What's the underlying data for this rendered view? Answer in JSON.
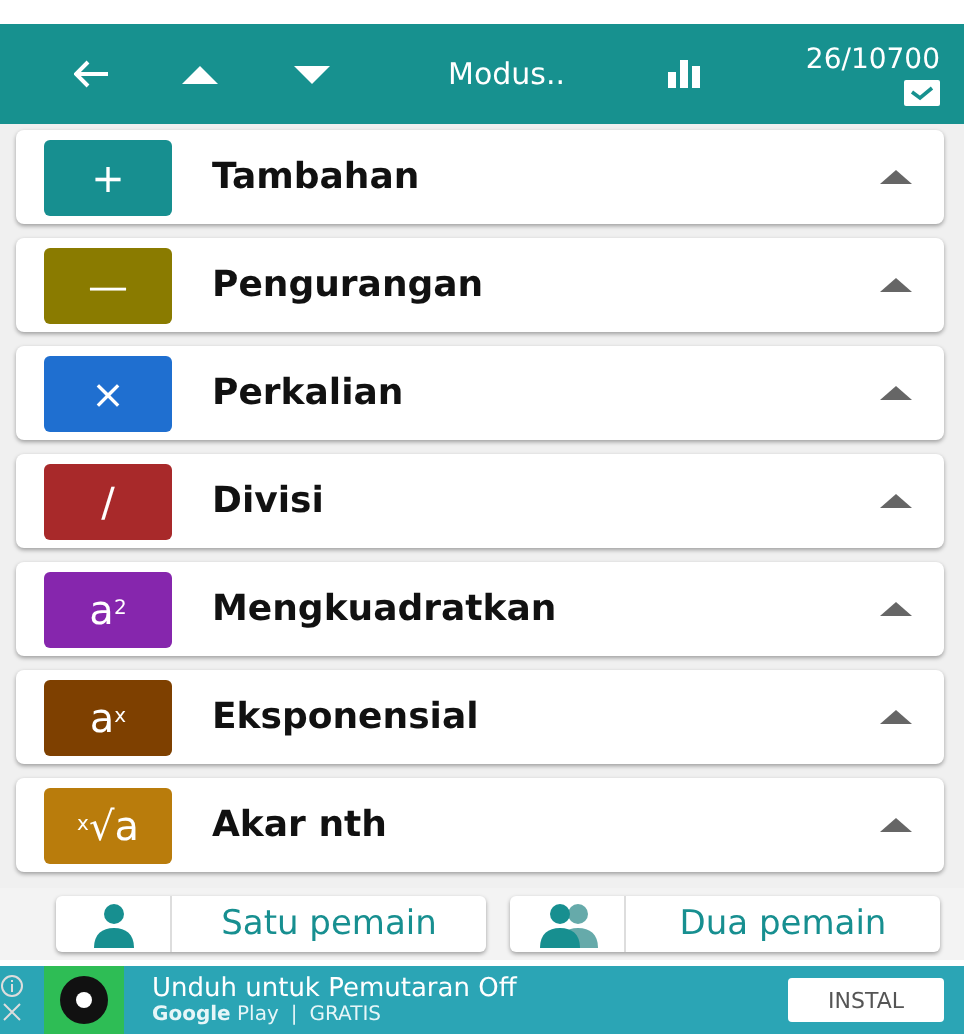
{
  "toolbar": {
    "title": "Modus..",
    "score": "26/10700"
  },
  "operations": [
    {
      "symbol": "+",
      "label": "Tambahan",
      "color": "#178f90"
    },
    {
      "symbol": "—",
      "label": "Pengurangan",
      "color": "#8a7b00"
    },
    {
      "symbol": "×",
      "label": "Perkalian",
      "color": "#1f6fd0"
    },
    {
      "symbol": "/",
      "label": "Divisi",
      "color": "#a8292a"
    },
    {
      "symbol": "a$^{2}$",
      "label": "Mengkuadratkan",
      "color": "#8626ad"
    },
    {
      "symbol": "a$^{x}$",
      "label": "Eksponensial",
      "color": "#7e4000"
    },
    {
      "symbol": "$^{x}$√a",
      "label": "Akar nth",
      "color": "#b97c0c"
    }
  ],
  "players": [
    {
      "label": "Satu pemain",
      "kind": "single"
    },
    {
      "label": "Dua pemain",
      "kind": "double"
    }
  ],
  "ad": {
    "title": "Unduh untuk Pemutaran Off",
    "store": "**Google** Play",
    "separator": "|",
    "price": "GRATIS",
    "button": "INSTAL"
  }
}
